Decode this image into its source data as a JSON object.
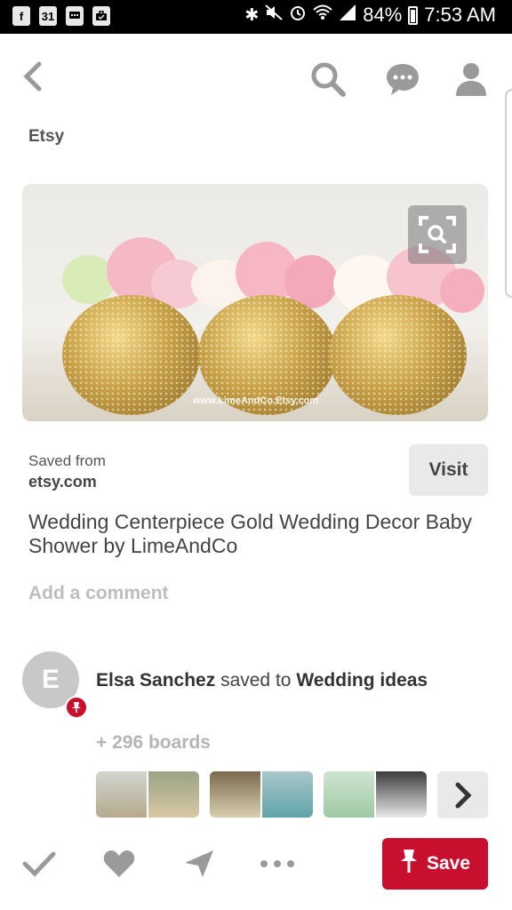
{
  "status_bar": {
    "left_icons": [
      "facebook-icon",
      "calendar-icon",
      "message-icon",
      "briefcase-icon"
    ],
    "calendar_day": "31",
    "battery": "84%",
    "time": "7:53 AM"
  },
  "header": {
    "icons": [
      "back-icon",
      "search-icon",
      "messages-icon",
      "profile-icon"
    ]
  },
  "pin": {
    "source_label": "Etsy",
    "image_watermark": "www.LimeAndCo.Etsy.com",
    "saved_from_label": "Saved from",
    "saved_from_site": "etsy.com",
    "visit_label": "Visit",
    "title": "Wedding Centerpiece Gold Wedding Decor Baby Shower by LimeAndCo",
    "add_comment": "Add a comment"
  },
  "saver": {
    "avatar_letter": "E",
    "name": "Elsa Sanchez",
    "saved_to_text": "saved to",
    "board": "Wedding ideas",
    "boards_count": "+ 296 boards"
  },
  "bottom_bar": {
    "save_label": "Save",
    "icons": [
      "check-icon",
      "heart-icon",
      "send-icon",
      "more-icon",
      "pin-icon"
    ]
  },
  "colors": {
    "brand_red": "#c8102e",
    "status_bar": "#000000",
    "muted_gray": "#9a9a9a"
  }
}
